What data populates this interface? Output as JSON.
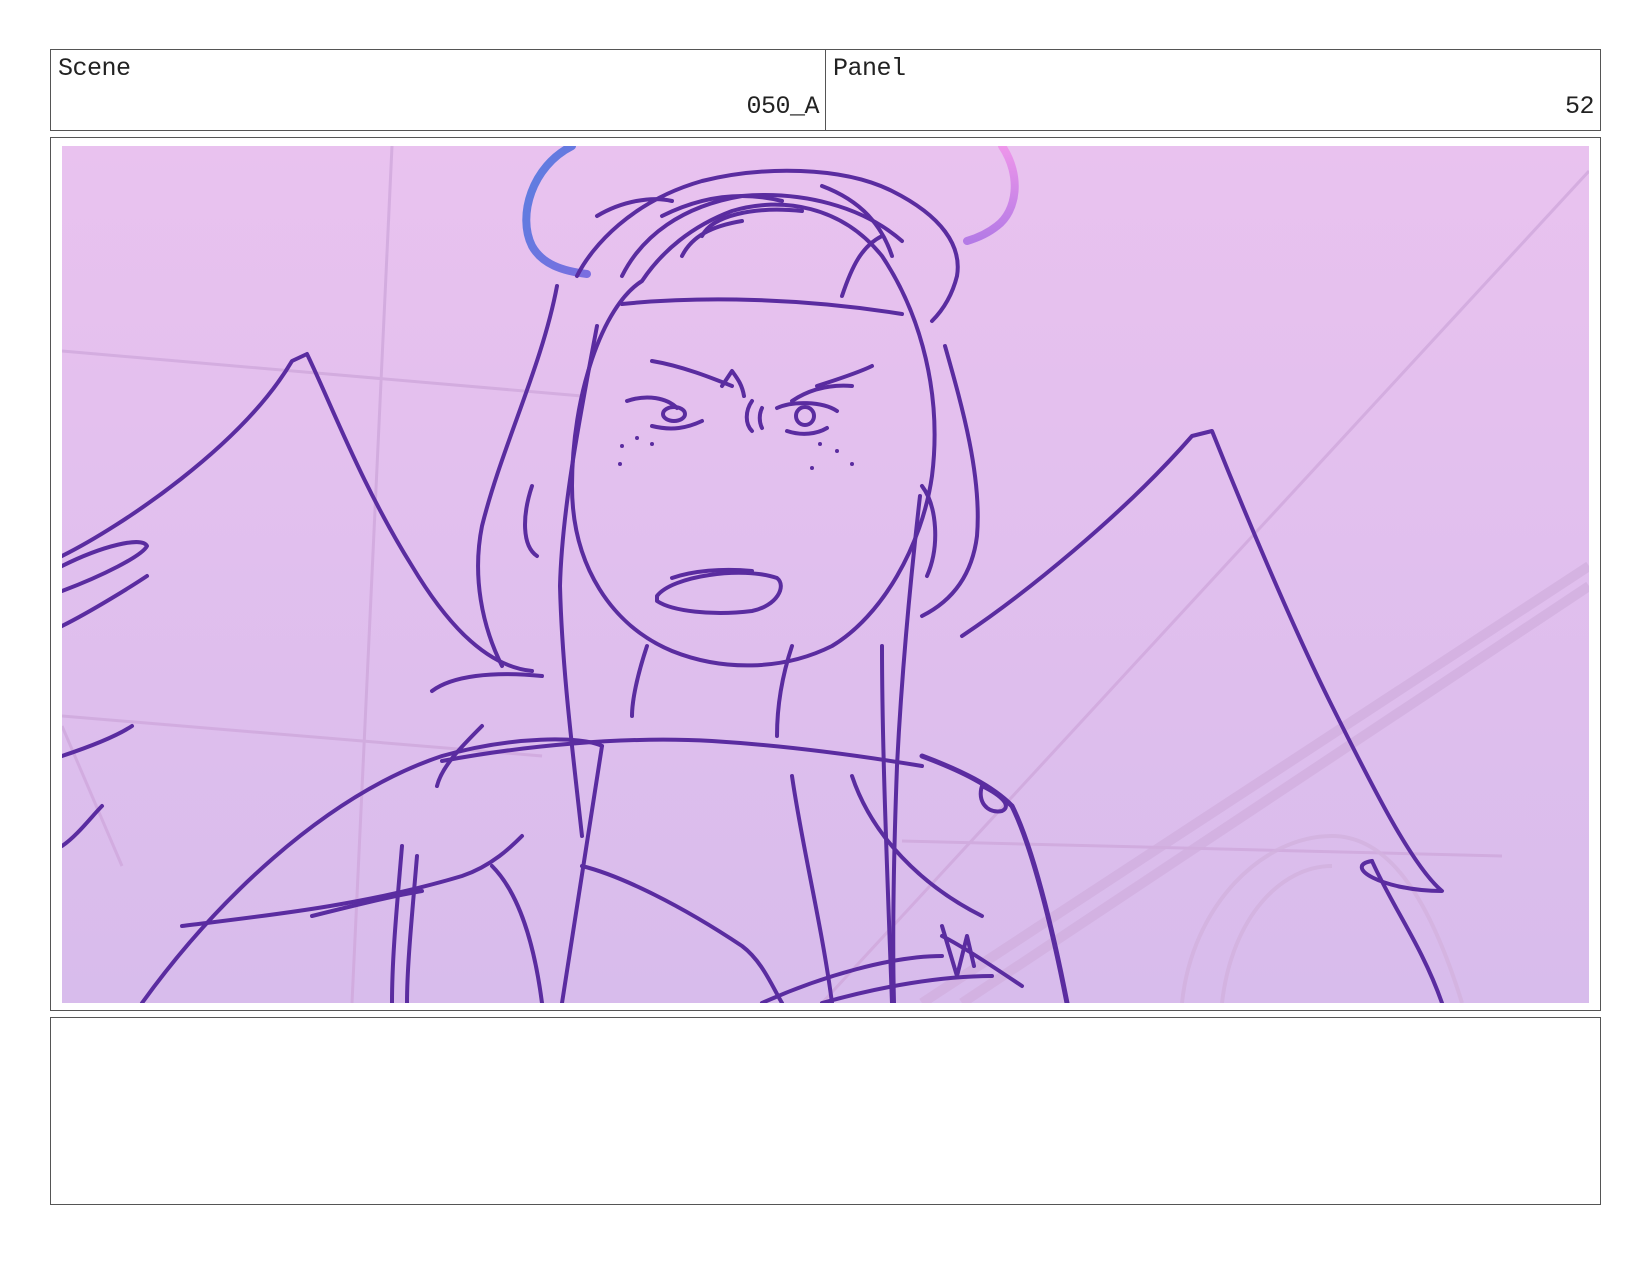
{
  "header": {
    "scene_label": "Scene",
    "scene_value": "050_A",
    "panel_label": "Panel",
    "panel_value": "52"
  },
  "panel": {
    "image_icon": "storyboard-sketch-icon",
    "colors": {
      "background_top": "#e9c2ef",
      "background_bottom": "#d8bcec",
      "line": "#5a2ca0",
      "halo_blue": "#5b7fe0",
      "halo_pink": "#e98fe6"
    }
  },
  "notes": {
    "text": ""
  }
}
